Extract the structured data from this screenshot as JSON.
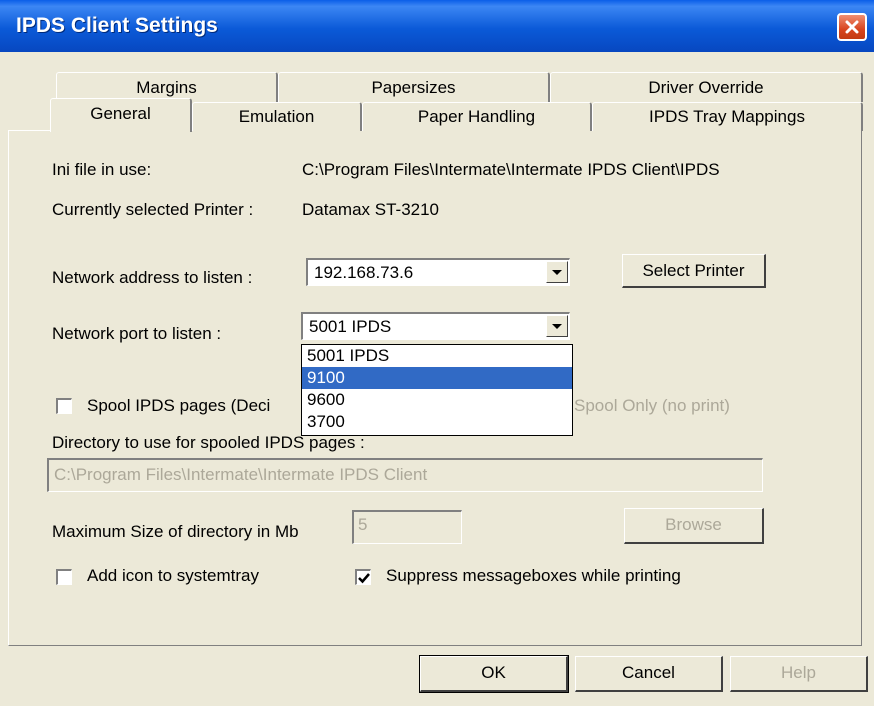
{
  "window": {
    "title": "IPDS Client Settings"
  },
  "tabs": {
    "row1": [
      "Margins",
      "Papersizes",
      "Driver Override"
    ],
    "row2": [
      "General",
      "Emulation",
      "Paper Handling",
      "IPDS Tray Mappings"
    ]
  },
  "general": {
    "ini_label": "Ini file in use:",
    "ini_value": "C:\\Program Files\\Intermate\\Intermate IPDS Client\\IPDS",
    "printer_label": "Currently selected Printer :",
    "printer_value": "Datamax ST-3210",
    "network_address_label": "Network address to listen :",
    "network_address_value": "192.168.73.6",
    "select_printer_label": "Select Printer",
    "network_port_label": "Network port to listen :",
    "network_port_value": "5001 IPDS",
    "port_options": [
      "5001 IPDS",
      "9100",
      "9600",
      "3700"
    ],
    "port_highlighted": "9100",
    "spool_label": "Spool IPDS pages (Deci",
    "spool_only_label": "Spool Only (no print)",
    "directory_label": "Directory to use for spooled IPDS pages :",
    "directory_value": "C:\\Program Files\\Intermate\\Intermate IPDS Client",
    "max_size_label": "Maximum Size of directory in Mb",
    "max_size_value": "5",
    "browse_label": "Browse",
    "systray_label": "Add icon to systemtray",
    "suppress_label": "Suppress messageboxes while printing"
  },
  "checkboxes": {
    "spool": false,
    "systray": false,
    "suppress": true
  },
  "footer": {
    "ok": "OK",
    "cancel": "Cancel",
    "help": "Help"
  }
}
